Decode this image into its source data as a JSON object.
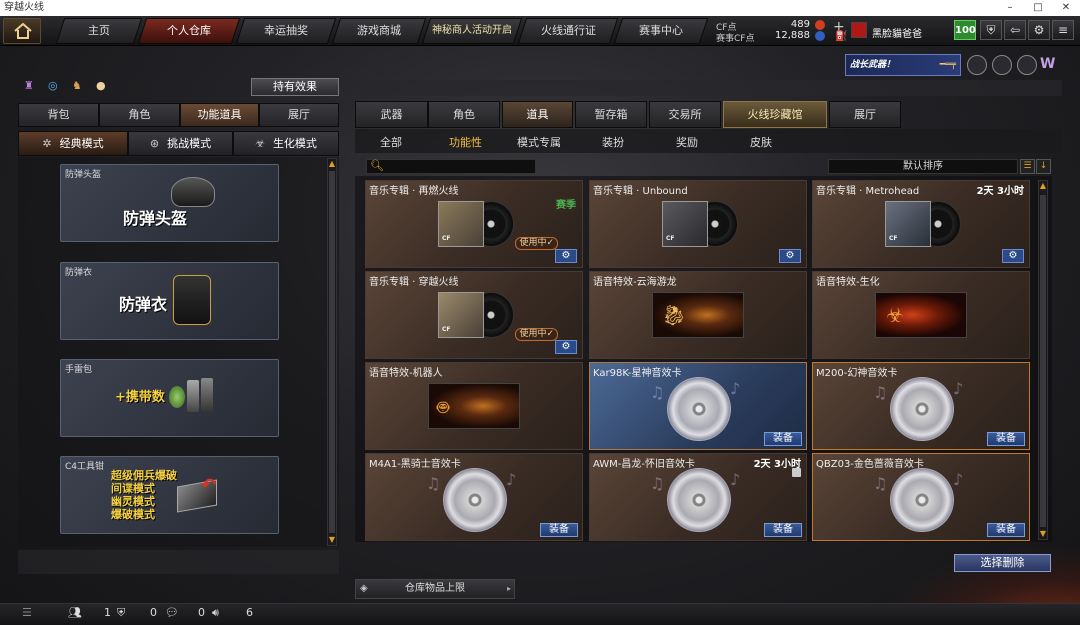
{
  "window": {
    "title": "穿越火线",
    "min": "–",
    "max": "□",
    "close": "✕"
  },
  "topnav": {
    "tabs": [
      "主页",
      "个人仓库",
      "幸运抽奖",
      "游戏商城",
      "神秘商人活动开启",
      "火线通行证",
      "赛事中心"
    ],
    "cf_label": "CF点",
    "cf_value": "489",
    "season_label": "赛事CF点",
    "season_value": "12,888",
    "username": "黑脸貓爸爸",
    "level": "100",
    "plus": "+"
  },
  "banner": {
    "text": "战长武器！"
  },
  "left": {
    "effect_button": "持有效果",
    "tabs": [
      "背包",
      "角色",
      "功能道具",
      "展厅"
    ],
    "mode_tabs": [
      "经典模式",
      "挑战模式",
      "生化模式"
    ],
    "cards": [
      {
        "corner": "防弹头盔",
        "title": "防弹头盔"
      },
      {
        "corner": "防弹衣",
        "title": "防弹衣"
      },
      {
        "corner": "手雷包",
        "title": "+携带数"
      },
      {
        "corner": "C4工具钳",
        "lines": [
          "超级佣兵爆破",
          "间谍模式",
          "幽灵模式",
          "爆破模式"
        ]
      }
    ]
  },
  "right": {
    "tabs": [
      "武器",
      "角色",
      "道具",
      "暂存箱",
      "交易所",
      "火线珍藏馆",
      "展厅"
    ],
    "subtabs": [
      "全部",
      "功能性",
      "模式专属",
      "装扮",
      "奖励",
      "皮肤"
    ],
    "sort_label": "默认排序",
    "items": [
      {
        "name": "音乐专辑 · 再燃火线",
        "badge": "赛季",
        "using": "使用中✓"
      },
      {
        "name": "音乐专辑 · Unbound"
      },
      {
        "name": "音乐专辑 · Metrohead",
        "time": "2天 3小时"
      },
      {
        "name": "音乐专辑 · 穿越火线",
        "using": "使用中✓"
      },
      {
        "name": "语音特效-云海游龙"
      },
      {
        "name": "语音特效-生化"
      },
      {
        "name": "语音特效-机器人"
      },
      {
        "name": "Kar98K-星神音效卡",
        "equip": "装备"
      },
      {
        "name": "M200-幻神音效卡",
        "equip": "装备"
      },
      {
        "name": "M4A1-黑骑士音效卡",
        "equip": "装备"
      },
      {
        "name": "AWM-昌龙-怀旧音效卡",
        "time": "2天 3小时",
        "equip": "装备"
      },
      {
        "name": "QBZ03-金色蔷薇音效卡",
        "equip": "装备"
      }
    ],
    "delete_button": "选择删除",
    "capacity_label": "仓库物品上限"
  },
  "statusbar": {
    "count1": "1",
    "count2": "0",
    "count3": "0",
    "count4": "6"
  },
  "colors": {
    "accent": "#f0c040",
    "equip": "#2a4a8a",
    "season": "#4caf50"
  }
}
